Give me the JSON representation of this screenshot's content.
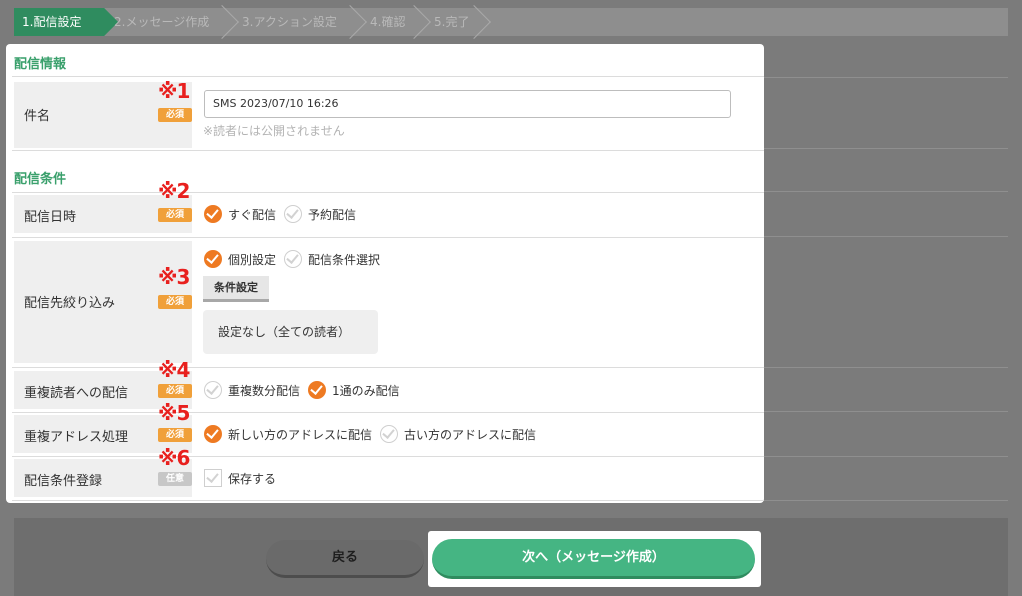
{
  "steps": [
    {
      "label": "1.配信設定",
      "active": true
    },
    {
      "label": "2.メッセージ作成",
      "active": false
    },
    {
      "label": "3.アクション設定",
      "active": false
    },
    {
      "label": "4.確認",
      "active": false
    },
    {
      "label": "5.完了",
      "active": false
    }
  ],
  "sections": {
    "delivery_info": "配信情報",
    "delivery_conditions": "配信条件"
  },
  "badges": {
    "required": "必須",
    "optional": "任意"
  },
  "rows": {
    "subject": {
      "label": "件名",
      "note": "※1",
      "value": "SMS 2023/07/10 16:26",
      "hint": "※読者には公開されません"
    },
    "datetime": {
      "label": "配信日時",
      "note": "※2",
      "options": [
        "すぐ配信",
        "予約配信"
      ],
      "selected": 0
    },
    "target": {
      "label": "配信先絞り込み",
      "note": "※3",
      "options": [
        "個別設定",
        "配信条件選択"
      ],
      "selected": 0,
      "condition_button": "条件設定",
      "condition_text": "設定なし（全ての読者）"
    },
    "duplicate_reader": {
      "label": "重複読者への配信",
      "note": "※4",
      "options": [
        "重複数分配信",
        "1通のみ配信"
      ],
      "selected": 1
    },
    "duplicate_address": {
      "label": "重複アドレス処理",
      "note": "※5",
      "options": [
        "新しい方のアドレスに配信",
        "古い方のアドレスに配信"
      ],
      "selected": 0
    },
    "register": {
      "label": "配信条件登録",
      "note": "※6",
      "checkbox_label": "保存する",
      "checked": false
    }
  },
  "footer": {
    "back_label": "戻る",
    "next_label": "次へ（メッセージ作成）"
  },
  "colors": {
    "accent_green": "#45b583",
    "accent_orange": "#ee7a22",
    "required_badge": "#f0a03a",
    "note_red": "#e8201e"
  }
}
